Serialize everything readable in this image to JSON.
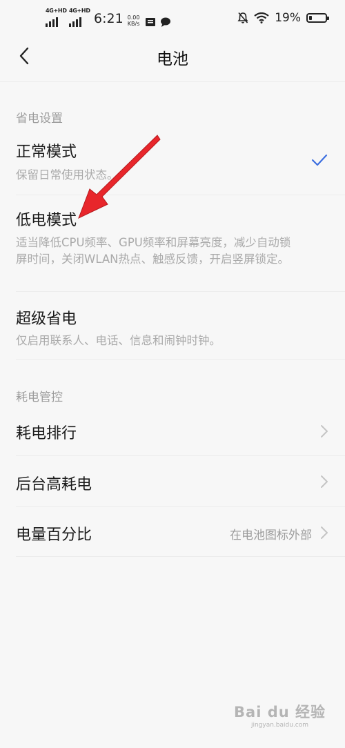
{
  "status_bar": {
    "net1": "4G+HD",
    "net2": "4G+HD",
    "time": "6:21",
    "speed_value": "0.00",
    "speed_unit": "KB/s",
    "battery_percent": "19%",
    "battery_level": 0.19
  },
  "header": {
    "title": "电池"
  },
  "power_settings": {
    "section_label": "省电设置",
    "modes": [
      {
        "title": "正常模式",
        "desc": "保留日常使用状态。"
      },
      {
        "title": "低电模式",
        "desc": "适当降低CPU频率、GPU频率和屏幕亮度，减少自动锁屏时间，关闭WLAN热点、触感反馈，开启竖屏锁定。"
      },
      {
        "title": "超级省电",
        "desc": "仅启用联系人、电话、信息和闹钟时钟。"
      }
    ]
  },
  "power_control": {
    "section_label": "耗电管控",
    "items": [
      {
        "title": "耗电排行"
      },
      {
        "title": "后台高耗电"
      },
      {
        "title": "电量百分比",
        "value": "在电池图标外部"
      }
    ]
  },
  "watermark": {
    "main": "Bai du 经验",
    "sub": "jingyan.baidu.com"
  },
  "colors": {
    "accent": "#3d6fe0",
    "annotation_arrow": "#e8262b"
  },
  "icons": [
    "back-arrow-icon",
    "check-icon",
    "chevron-right-icon",
    "mute-icon",
    "wifi-icon",
    "battery-icon",
    "message-icon",
    "sim-card-icon"
  ]
}
